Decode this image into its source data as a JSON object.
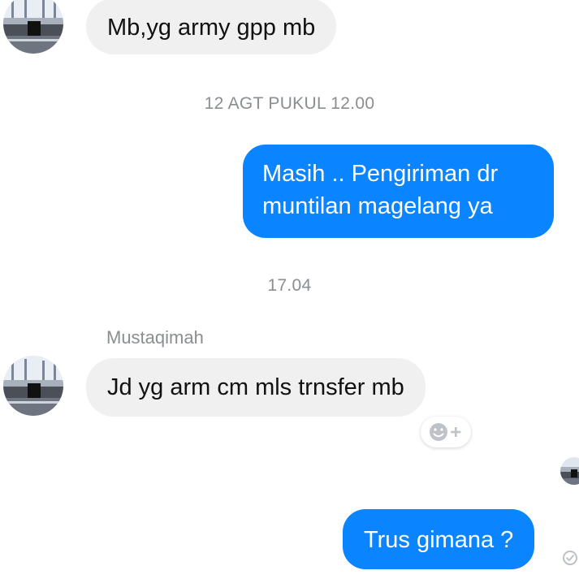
{
  "contact": {
    "name": "Mustaqimah",
    "avatar_icon": "kaaba-photo-avatar"
  },
  "messages": [
    {
      "direction": "incoming",
      "text": "Mb,yg army gpp mb"
    },
    {
      "direction": "outgoing",
      "text_lines": [
        "Masih .. Pengiriman dr",
        "muntilan magelang ya"
      ]
    },
    {
      "direction": "incoming",
      "text": "Jd yg arm cm mls trnsfer mb"
    },
    {
      "direction": "outgoing",
      "text": "Trus gimana ?"
    }
  ],
  "timestamps": [
    "12 AGT PUKUL 12.00",
    "17.04"
  ],
  "reaction_button_icon": "add-reaction-icon",
  "seen_indicator_icon": "seen-avatar-icon",
  "sent_status_icon": "sent-check-icon",
  "colors": {
    "incoming_bubble": "#f1f0f0",
    "outgoing_bubble": "#0a84ff",
    "timestamp_text": "#8a8d91"
  }
}
